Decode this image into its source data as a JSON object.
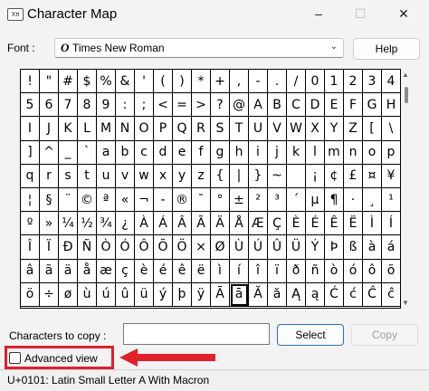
{
  "window": {
    "title": "Character Map",
    "minimize": "–",
    "maximize": "☐",
    "close": "✕"
  },
  "font": {
    "label": "Font :",
    "glyph": "O",
    "value": "Times New Roman",
    "help_label": "Help"
  },
  "grid": {
    "rows": [
      [
        "!",
        "\"",
        "#",
        "$",
        "%",
        "&",
        "'",
        "(",
        ")",
        "*",
        "+",
        ",",
        "-",
        ".",
        "/",
        "0",
        "1",
        "2",
        "3",
        "4"
      ],
      [
        "5",
        "6",
        "7",
        "8",
        "9",
        ":",
        ";",
        "<",
        "=",
        ">",
        "?",
        "@",
        "A",
        "B",
        "C",
        "D",
        "E",
        "F",
        "G",
        "H"
      ],
      [
        "I",
        "J",
        "K",
        "L",
        "M",
        "N",
        "O",
        "P",
        "Q",
        "R",
        "S",
        "T",
        "U",
        "V",
        "W",
        "X",
        "Y",
        "Z",
        "[",
        "\\"
      ],
      [
        "]",
        "^",
        "_",
        "`",
        "a",
        "b",
        "c",
        "d",
        "e",
        "f",
        "g",
        "h",
        "i",
        "j",
        "k",
        "l",
        "m",
        "n",
        "o",
        "p"
      ],
      [
        "q",
        "r",
        "s",
        "t",
        "u",
        "v",
        "w",
        "x",
        "y",
        "z",
        "{",
        "|",
        "}",
        "~",
        "",
        "¡",
        "¢",
        "£",
        "¤",
        "¥"
      ],
      [
        "¦",
        "§",
        "¨",
        "©",
        "ª",
        "«",
        "¬",
        "-",
        "®",
        "¯",
        "°",
        "±",
        "²",
        "³",
        "´",
        "µ",
        "¶",
        "·",
        "¸",
        "¹"
      ],
      [
        "º",
        "»",
        "¼",
        "½",
        "¾",
        "¿",
        "À",
        "Á",
        "Â",
        "Ã",
        "Ä",
        "Å",
        "Æ",
        "Ç",
        "È",
        "É",
        "Ê",
        "Ë",
        "Ì",
        "Í"
      ],
      [
        "Î",
        "Ï",
        "Ð",
        "Ñ",
        "Ò",
        "Ó",
        "Ô",
        "Õ",
        "Ö",
        "×",
        "Ø",
        "Ù",
        "Ú",
        "Û",
        "Ü",
        "Ý",
        "Þ",
        "ß",
        "à",
        "á"
      ],
      [
        "â",
        "ã",
        "ä",
        "å",
        "æ",
        "ç",
        "è",
        "é",
        "ê",
        "ë",
        "ì",
        "í",
        "î",
        "ï",
        "ð",
        "ñ",
        "ò",
        "ó",
        "ô",
        "õ"
      ],
      [
        "ö",
        "÷",
        "ø",
        "ù",
        "ú",
        "û",
        "ü",
        "ý",
        "þ",
        "ÿ",
        "Ā",
        "ā",
        "Ă",
        "ă",
        "Ą",
        "ą",
        "Ć",
        "ć",
        "Ĉ",
        "ĉ"
      ]
    ],
    "selected": {
      "row": 9,
      "col": 11
    }
  },
  "copy": {
    "label": "Characters to copy :",
    "value": "",
    "select_label": "Select",
    "copy_label": "Copy"
  },
  "advanced": {
    "label": "Advanced view",
    "checked": false
  },
  "annotation": {
    "box_color": "#e0202a",
    "arrow_color": "#e0202a"
  },
  "status": {
    "text": "U+0101: Latin Small Letter A With Macron"
  },
  "icons": {
    "app": "character-map-icon",
    "font": "opentype-font-icon",
    "dropdown": "chevron-down-icon"
  }
}
